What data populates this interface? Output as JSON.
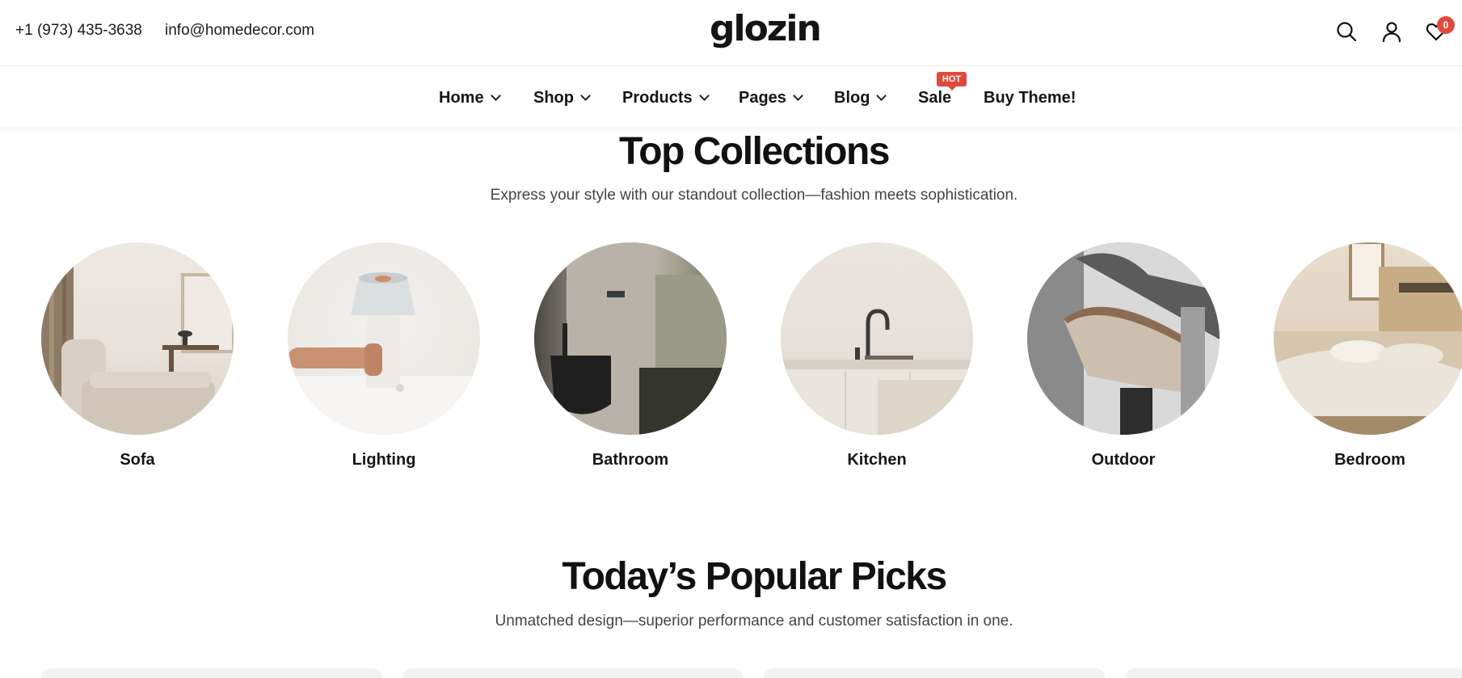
{
  "topbar": {
    "phone": "+1 (973) 435-3638",
    "email": "info@homedecor.com",
    "logo": "glozin",
    "icons": [
      "search-icon",
      "account-icon",
      "wishlist-icon"
    ],
    "wishlist_count": "0"
  },
  "nav": {
    "items": [
      {
        "label": "Home",
        "dropdown": true
      },
      {
        "label": "Shop",
        "dropdown": true
      },
      {
        "label": "Products",
        "dropdown": true
      },
      {
        "label": "Pages",
        "dropdown": true
      },
      {
        "label": "Blog",
        "dropdown": true
      },
      {
        "label": "Sale",
        "dropdown": false
      },
      {
        "label": "Buy Theme!",
        "dropdown": false
      }
    ],
    "sale_badge": "HOT"
  },
  "collections": {
    "title": "Top Collections",
    "subtitle": "Express your style with our standout collection—fashion meets sophistication.",
    "items": [
      {
        "label": "Sofa"
      },
      {
        "label": "Lighting"
      },
      {
        "label": "Bathroom"
      },
      {
        "label": "Kitchen"
      },
      {
        "label": "Outdoor"
      },
      {
        "label": "Bedroom"
      }
    ]
  },
  "popular": {
    "title": "Today’s Popular Picks",
    "subtitle": "Unmatched design—superior performance and customer satisfaction in one."
  },
  "colors": {
    "accent_red": "#e04a3d",
    "text_dark": "#111111",
    "text_muted": "#444444"
  }
}
